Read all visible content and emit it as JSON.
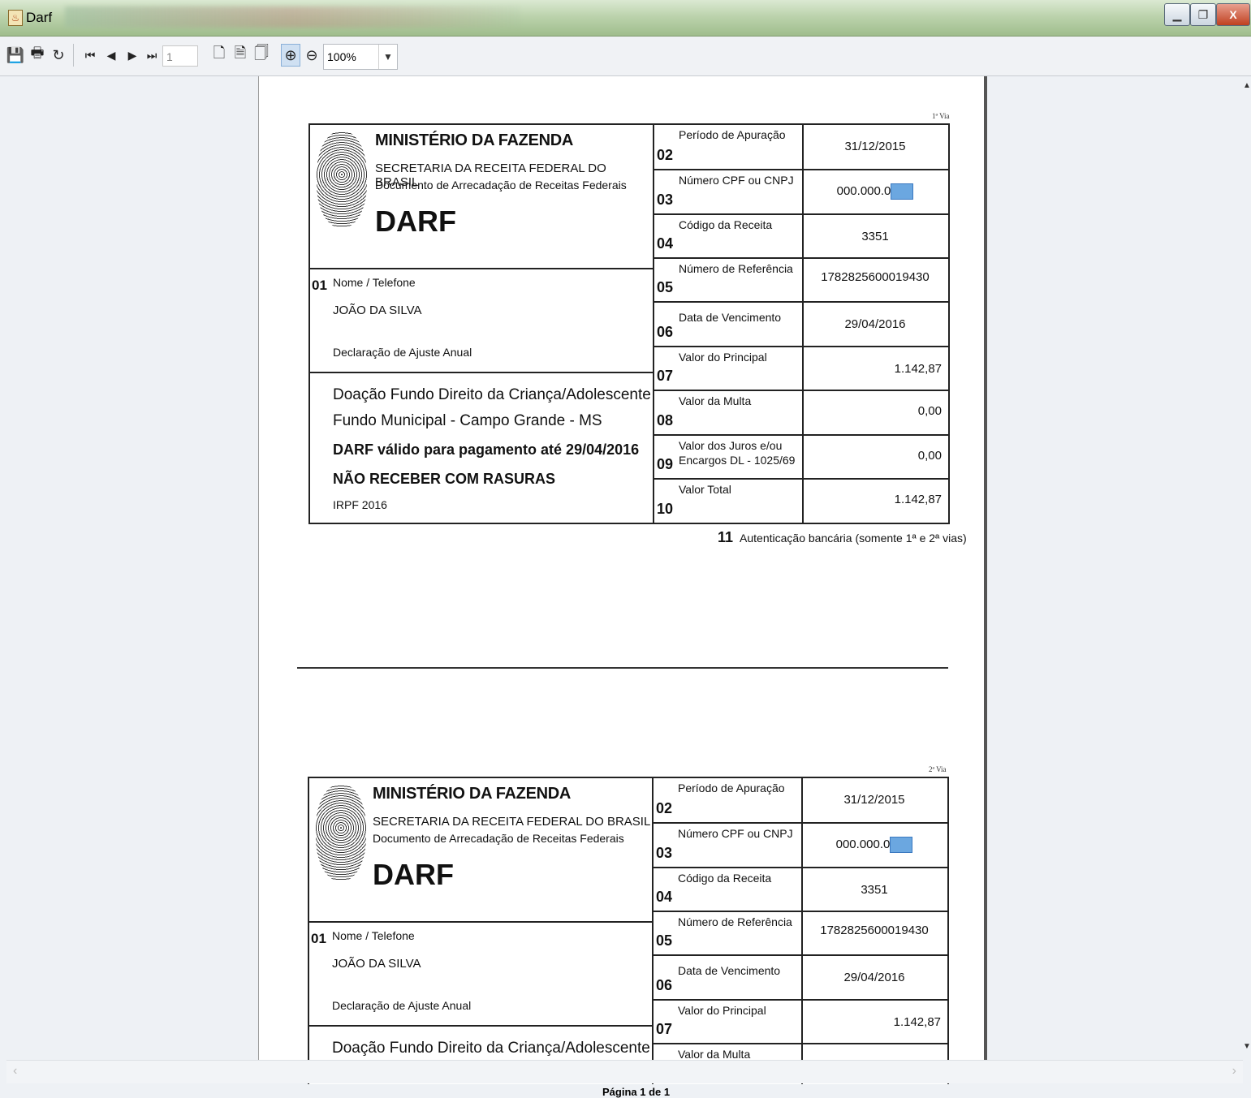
{
  "window": {
    "title": "Darf",
    "controls": [
      "minimize",
      "restore",
      "close"
    ]
  },
  "toolbar": {
    "page_number": "1",
    "zoom": "100%"
  },
  "status": {
    "page_info": "Página 1 de 1"
  },
  "copies": [
    {
      "via": "1ª Via",
      "ministerio": "MINISTÉRIO DA FAZENDA",
      "secretaria": "SECRETARIA DA RECEITA FEDERAL DO BRASIL",
      "documento": "Documento de Arrecadação de Receitas Federais",
      "darf": "DARF",
      "f01": {
        "num": "01",
        "label": "Nome / Telefone",
        "name": "JOÃO DA SILVA",
        "desc": "Declaração de Ajuste Anual"
      },
      "info": {
        "line1": "Doação Fundo Direito da Criança/Adolescente",
        "line2": "Fundo Municipal - Campo Grande - MS",
        "line3": "DARF válido para pagamento até 29/04/2016",
        "line4": "NÃO RECEBER COM RASURAS",
        "line5": "IRPF 2016"
      },
      "fields": [
        {
          "num": "02",
          "label": "Período de Apuração",
          "value": "31/12/2015"
        },
        {
          "num": "03",
          "label": "Número CPF ou CNPJ",
          "value": "000.000.0"
        },
        {
          "num": "04",
          "label": "Código da Receita",
          "value": "3351"
        },
        {
          "num": "05",
          "label": "Número de Referência",
          "value": "1782825600019430"
        },
        {
          "num": "06",
          "label": "Data de Vencimento",
          "value": "29/04/2016"
        },
        {
          "num": "07",
          "label": "Valor do Principal",
          "value": "1.142,87"
        },
        {
          "num": "08",
          "label": "Valor da Multa",
          "value": "0,00"
        },
        {
          "num": "09",
          "label": "Valor dos Juros e/ou",
          "label2": "Encargos DL - 1025/69",
          "value": "0,00"
        },
        {
          "num": "10",
          "label": "Valor Total",
          "value": "1.142,87"
        }
      ],
      "auth": {
        "num": "11",
        "label": "Autenticação bancária (somente 1ª e 2ª vias)"
      }
    },
    {
      "via": "2ª Via",
      "ministerio": "MINISTÉRIO DA FAZENDA",
      "secretaria": "SECRETARIA DA RECEITA FEDERAL DO BRASIL",
      "documento": "Documento de Arrecadação de Receitas Federais",
      "darf": "DARF",
      "f01": {
        "num": "01",
        "label": "Nome / Telefone",
        "name": "JOÃO DA SILVA",
        "desc": "Declaração de Ajuste Anual"
      },
      "info": {
        "line1": "Doação Fundo Direito da Criança/Adolescente"
      },
      "fields": [
        {
          "num": "02",
          "label": "Período de Apuração",
          "value": "31/12/2015"
        },
        {
          "num": "03",
          "label": "Número CPF ou CNPJ",
          "value": "000.000.0"
        },
        {
          "num": "04",
          "label": "Código da Receita",
          "value": "3351"
        },
        {
          "num": "05",
          "label": "Número de Referência",
          "value": "1782825600019430"
        },
        {
          "num": "06",
          "label": "Data de Vencimento",
          "value": "29/04/2016"
        },
        {
          "num": "07",
          "label": "Valor do Principal",
          "value": "1.142,87"
        },
        {
          "num": "08",
          "label": "Valor da Multa"
        }
      ]
    }
  ]
}
